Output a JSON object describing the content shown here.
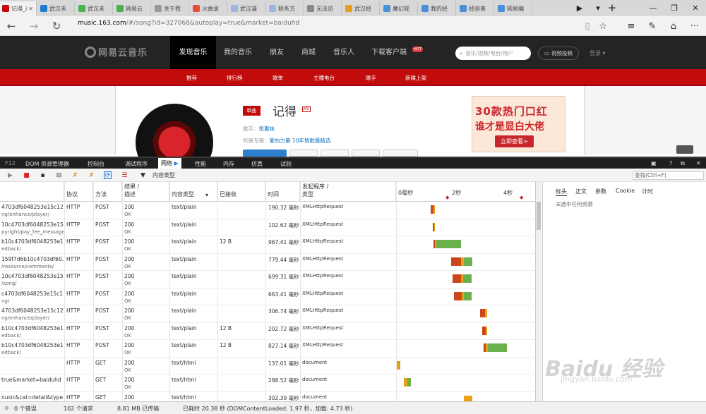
{
  "browser": {
    "tabs": [
      "记得_i",
      "武汉未",
      "武汉未",
      "网易云",
      "关于我",
      "火曲录",
      "武汉漫",
      "联系方",
      "无法访",
      "武汉经",
      "魔幻观",
      "我的经",
      "经验普",
      "网易编"
    ],
    "url_host": "music.163.com",
    "url_rest": "/#/song?id=327068&autoplay=true&market=baiduhd"
  },
  "site": {
    "logo": "网易云音乐",
    "nav": [
      "发现音乐",
      "我的音乐",
      "朋友",
      "商城",
      "音乐人",
      "下载客户端"
    ],
    "hot_badge": "HOT",
    "search_placeholder": "音乐/视频/电台/用户",
    "video_button": "视频投稿",
    "login": "登录",
    "subnav": [
      "推荐",
      "排行榜",
      "歌单",
      "主播电台",
      "歌手",
      "新碟上架"
    ]
  },
  "song": {
    "badge": "单曲",
    "title": "记得",
    "mv": "MV",
    "singer_label": "歌手：",
    "singer": "张惠妹",
    "album_label": "所属专辑：",
    "album": "爱的力量 10年情歌最精选"
  },
  "ad": {
    "line1": "30款热门口红",
    "line2": "谁才是显白大佬",
    "button": "立即查看>"
  },
  "devtools": {
    "tabs": [
      "F12",
      "DOM 资源管理器",
      "控制台",
      "调试程序",
      "网络",
      "性能",
      "内存",
      "仿真",
      "试验"
    ],
    "filter_label": "内容类型",
    "find_placeholder": "查找(Ctrl+F)",
    "columns": {
      "protocol": "协议",
      "method": "方法",
      "result": "结果 /",
      "result2": "描述",
      "content_type": "内容类型",
      "received": "已接收",
      "time": "时间",
      "initiator": "发起程序 /",
      "initiator2": "类型",
      "timeline_ticks": [
        "0毫秒",
        "2秒",
        "4秒"
      ]
    },
    "requests": [
      {
        "name": "4703df6048253e15c12ef",
        "path": "ng/enhance/player/",
        "protocol": "HTTP",
        "method": "POST",
        "result": "200",
        "desc": "OK",
        "ctype": "text/plain",
        "received": "",
        "time": "190.32 毫秒",
        "initiator": "XMLHttpRequest",
        "bars": [
          {
            "start": 610,
            "w": 4,
            "c": "#c9471b"
          },
          {
            "start": 614,
            "w": 2,
            "c": "#e7a21a"
          }
        ]
      },
      {
        "name": "10c4703df6048253e15...",
        "path": "pyright/pay_fee_message/",
        "protocol": "HTTP",
        "method": "POST",
        "result": "200",
        "desc": "OK",
        "ctype": "text/plain",
        "received": "",
        "time": "102.62 毫秒",
        "initiator": "XMLHttpRequest",
        "bars": [
          {
            "start": 613,
            "w": 2,
            "c": "#c9471b"
          },
          {
            "start": 615,
            "w": 1,
            "c": "#e7a21a"
          }
        ]
      },
      {
        "name": "b10c4703df6048253e1...",
        "path": "edback/",
        "protocol": "HTTP",
        "method": "POST",
        "result": "200",
        "desc": "OK",
        "ctype": "text/plain",
        "received": "12 B",
        "time": "967.41 毫秒",
        "initiator": "XMLHttpRequest",
        "bars": [
          {
            "start": 614,
            "w": 2,
            "c": "#c9471b"
          },
          {
            "start": 616,
            "w": 2,
            "c": "#e7a21a"
          },
          {
            "start": 618,
            "w": 35,
            "c": "#6ab04c"
          }
        ]
      },
      {
        "name": "159f7d6b10c4703df60...",
        "path": "/resource/comments/",
        "protocol": "HTTP",
        "method": "POST",
        "result": "200",
        "desc": "OK",
        "ctype": "text/plain",
        "received": "",
        "time": "779.44 毫秒",
        "initiator": "XMLHttpRequest",
        "bars": [
          {
            "start": 639,
            "w": 14,
            "c": "#c9471b"
          },
          {
            "start": 653,
            "w": 4,
            "c": "#e7a21a"
          },
          {
            "start": 657,
            "w": 12,
            "c": "#6ab04c"
          }
        ]
      },
      {
        "name": "10c4703df6048253e15c...",
        "path": "/song/",
        "protocol": "HTTP",
        "method": "POST",
        "result": "200",
        "desc": "OK",
        "ctype": "text/plain",
        "received": "",
        "time": "699.31 毫秒",
        "initiator": "XMLHttpRequest",
        "bars": [
          {
            "start": 641,
            "w": 12,
            "c": "#c9471b"
          },
          {
            "start": 653,
            "w": 3,
            "c": "#e7a21a"
          },
          {
            "start": 656,
            "w": 12,
            "c": "#6ab04c"
          }
        ]
      },
      {
        "name": "c4703df6048253e15c1...",
        "path": "ng/",
        "protocol": "HTTP",
        "method": "POST",
        "result": "200",
        "desc": "OK",
        "ctype": "text/plain",
        "received": "",
        "time": "663.41 毫秒",
        "initiator": "XMLHttpRequest",
        "bars": [
          {
            "start": 643,
            "w": 11,
            "c": "#c9471b"
          },
          {
            "start": 654,
            "w": 3,
            "c": "#e7a21a"
          },
          {
            "start": 657,
            "w": 11,
            "c": "#6ab04c"
          }
        ]
      },
      {
        "name": "4703df6048253e15c12ef",
        "path": "ng/enhance/player/",
        "protocol": "HTTP",
        "method": "POST",
        "result": "200",
        "desc": "OK",
        "ctype": "text/plain",
        "received": "",
        "time": "306.74 毫秒",
        "initiator": "XMLHttpRequest",
        "bars": [
          {
            "start": 680,
            "w": 7,
            "c": "#c9471b"
          },
          {
            "start": 687,
            "w": 3,
            "c": "#e7a21a"
          }
        ]
      },
      {
        "name": "b10c4703df6048253e1...",
        "path": "edback/",
        "protocol": "HTTP",
        "method": "POST",
        "result": "200",
        "desc": "OK",
        "ctype": "text/plain",
        "received": "12 B",
        "time": "202.72 毫秒",
        "initiator": "XMLHttpRequest",
        "bars": [
          {
            "start": 683,
            "w": 5,
            "c": "#c9471b"
          },
          {
            "start": 688,
            "w": 2,
            "c": "#e7a21a"
          }
        ]
      },
      {
        "name": "b10c4703df6048253e1...",
        "path": "edback/",
        "protocol": "HTTP",
        "method": "POST",
        "result": "200",
        "desc": "OK",
        "ctype": "text/plain",
        "received": "12 B",
        "time": "827.14 毫秒",
        "initiator": "XMLHttpRequest",
        "bars": [
          {
            "start": 685,
            "w": 3,
            "c": "#c9471b"
          },
          {
            "start": 688,
            "w": 3,
            "c": "#e7a21a"
          },
          {
            "start": 691,
            "w": 27,
            "c": "#6ab04c"
          }
        ]
      },
      {
        "name": "",
        "path": "",
        "protocol": "HTTP",
        "method": "GET",
        "result": "200",
        "desc": "OK",
        "ctype": "text/html",
        "received": "",
        "time": "137.01 毫秒",
        "initiator": "document",
        "bars": [
          {
            "start": 562,
            "w": 4,
            "c": "#e7a21a"
          },
          {
            "start": 566,
            "w": 1,
            "c": "#6ab04c"
          }
        ]
      },
      {
        "name": "true&market=baiduhd",
        "path": "",
        "protocol": "HTTP",
        "method": "GET",
        "result": "200",
        "desc": "OK",
        "ctype": "text/html",
        "received": "",
        "time": "288.52 毫秒",
        "initiator": "document",
        "bars": [
          {
            "start": 572,
            "w": 5,
            "c": "#e7a21a"
          },
          {
            "start": 577,
            "w": 5,
            "c": "#6ab04c"
          }
        ]
      },
      {
        "name": "nusic&cat=detail&type...",
        "path": "",
        "protocol": "HTTP",
        "method": "GET",
        "result": "200",
        "desc": "OK",
        "ctype": "text/html",
        "received": "",
        "time": "302.39 毫秒",
        "initiator": "document",
        "bars": [
          {
            "start": 657,
            "w": 12,
            "c": "#e7a21a"
          }
        ]
      }
    ],
    "side_tabs": [
      "标头",
      "正文",
      "参数",
      "Cookie",
      "计时"
    ],
    "side_empty": "未选中任何资源",
    "status": {
      "errors": "0 个错误",
      "requests": "102 个请求",
      "transferred": "8.81 MB 已传输",
      "timing": "已耗时 20.38 秒 (DOMContentLoaded: 1.97 秒，加载: 4.73 秒)"
    }
  },
  "watermark": {
    "line1": "Baidu 经验",
    "line2": "jingyan.baidu.com"
  },
  "colors": {
    "brand_red": "#c20c0c",
    "header_dark": "#242424",
    "wait": "#c9471b",
    "send": "#e7a21a",
    "receive": "#6ab04c"
  }
}
